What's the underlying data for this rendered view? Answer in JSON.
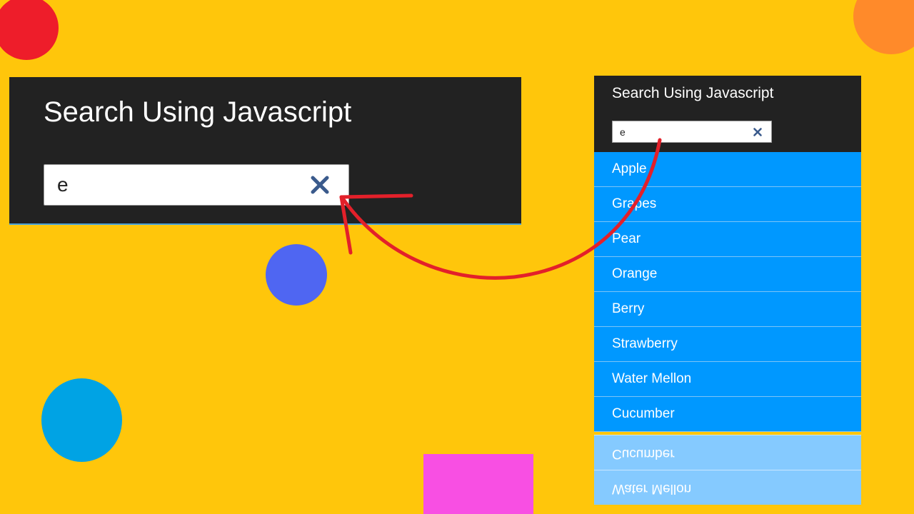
{
  "colors": {
    "background": "#ffc60b",
    "panel": "#222222",
    "list_item": "#0098ff",
    "list_reflection": "#85caff",
    "arrow": "#e3202a",
    "deco_red": "#ee1d2a",
    "deco_orange": "#ff8a2a",
    "deco_blue": "#4f66f2",
    "deco_cyan": "#00a3e4",
    "deco_pink": "#f84fe3",
    "clear_icon": "#3a5a8c"
  },
  "big_panel": {
    "title": "Search Using Javascript",
    "search_value": "e",
    "clear_icon": "close-icon"
  },
  "side_panel": {
    "title": "Search Using Javascript",
    "search_value": "e",
    "clear_icon": "close-icon",
    "items": [
      "Apple",
      "Grapes",
      "Pear",
      "Orange",
      "Berry",
      "Strawberry",
      "Water Mellon",
      "Cucumber"
    ],
    "reflected_items": [
      "Cucumber",
      "Water Mellon"
    ]
  }
}
